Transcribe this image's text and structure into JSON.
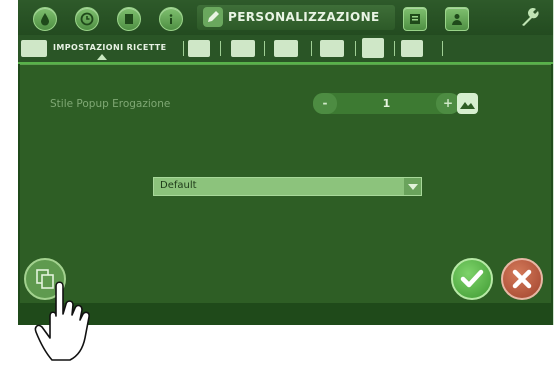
{
  "header": {
    "active_tab": "PERSONALIZZAZIONE",
    "icons": [
      "drop-icon",
      "clock-icon",
      "machine-icon",
      "info-icon",
      "pen-icon",
      "book-icon",
      "user-icon",
      "wrench-icon"
    ]
  },
  "subtabs": {
    "active": "IMPOSTAZIONI RICETTE",
    "icons": [
      "recipe-book-icon",
      "book-open-icon",
      "image-icon",
      "frame-icon",
      "speaker-icon",
      "cup-icon",
      "palette-icon"
    ]
  },
  "main": {
    "setting_label": "Stile Popup Erogazione",
    "stepper": {
      "minus": "-",
      "value": "1",
      "plus": "+"
    },
    "select_value": "Default"
  },
  "colors": {
    "background": "#2e5e25",
    "accent": "#58b24a",
    "ok": "#4fb23d",
    "cancel": "#c0553a"
  }
}
